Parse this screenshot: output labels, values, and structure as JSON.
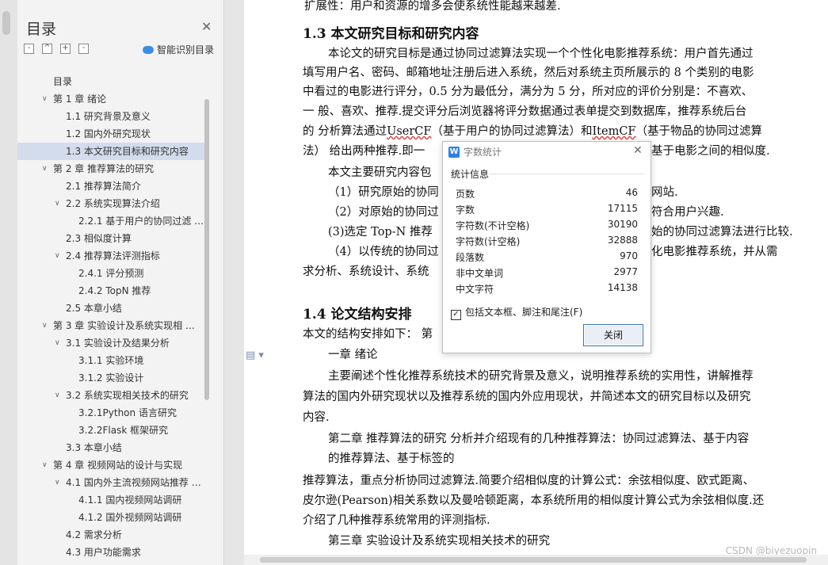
{
  "toc": {
    "title": "目录",
    "smart_label": "智能识别目录",
    "toolbar": [
      "-",
      "^",
      "+",
      "-"
    ],
    "items": [
      {
        "label": "目录",
        "level": 0,
        "chev": ""
      },
      {
        "label": "第 1 章 绪论",
        "level": 0,
        "chev": "v"
      },
      {
        "label": "1.1 研究背景及意义",
        "level": 1,
        "chev": ""
      },
      {
        "label": "1.2 国内外研究现状",
        "level": 1,
        "chev": ""
      },
      {
        "label": "1.3 本文研究目标和研究内容",
        "level": 1,
        "chev": "",
        "selected": true
      },
      {
        "label": "第 2 章 推荐算法的研究",
        "level": 0,
        "chev": "v"
      },
      {
        "label": "2.1 推荐算法简介",
        "level": 1,
        "chev": ""
      },
      {
        "label": "2.2 系统实现算法介绍",
        "level": 1,
        "chev": "v"
      },
      {
        "label": "2.2.1 基于用户的协同过滤 …",
        "level": 2,
        "chev": ""
      },
      {
        "label": "2.3 相似度计算",
        "level": 1,
        "chev": ""
      },
      {
        "label": "2.4 推荐算法评测指标",
        "level": 1,
        "chev": "v"
      },
      {
        "label": "2.4.1 评分预测",
        "level": 2,
        "chev": ""
      },
      {
        "label": "2.4.2 TopN 推荐",
        "level": 2,
        "chev": ""
      },
      {
        "label": "2.5 本章小结",
        "level": 1,
        "chev": ""
      },
      {
        "label": "第 3 章 实验设计及系统实现相 …",
        "level": 0,
        "chev": "v"
      },
      {
        "label": "3.1 实验设计及结果分析",
        "level": 1,
        "chev": "v"
      },
      {
        "label": "3.1.1 实验环境",
        "level": 2,
        "chev": ""
      },
      {
        "label": "3.1.2 实验设计",
        "level": 2,
        "chev": ""
      },
      {
        "label": "3.2 系统实现相关技术的研究",
        "level": 1,
        "chev": "v"
      },
      {
        "label": "3.2.1Python 语言研究",
        "level": 2,
        "chev": ""
      },
      {
        "label": "3.2.2Flask 框架研究",
        "level": 2,
        "chev": ""
      },
      {
        "label": "3.3 本章小结",
        "level": 1,
        "chev": ""
      },
      {
        "label": "第 4 章 视频网站的设计与实现",
        "level": 0,
        "chev": "v"
      },
      {
        "label": "4.1 国内外主流视频网站推荐 …",
        "level": 1,
        "chev": "v"
      },
      {
        "label": "4.1.1 国内视频网站调研",
        "level": 2,
        "chev": ""
      },
      {
        "label": "4.1.2 国外视频网站调研",
        "level": 2,
        "chev": ""
      },
      {
        "label": "4.2 需求分析",
        "level": 1,
        "chev": ""
      },
      {
        "label": "4.3 用户功能需求",
        "level": 1,
        "chev": ""
      }
    ]
  },
  "doc": {
    "lines": [
      "扩展性：用户和资源的增多会使系统性能越来越差.",
      "1.3  本文研究目标和研究内容",
      "本论文的研究目标是通过协同过滤算法实现一个个性化电影推荐系统：用户首先通过",
      "填写用户名、密码、邮箱地址注册后进入系统，然后对系统主页所展示的 8 个类别的电影",
      "中看过的电影进行评分，0.5 分为最低分，满分为 5 分，所对应的评价分别是：不喜欢、",
      "一  般、喜欢、推荐.提交评分后浏览器将评分数据通过表单提交到数据库，推荐系统后台",
      "的  分析算法通过",
      "UserCF",
      "（基于用户的协同过滤算法）和",
      "ItemCF",
      "（基于物品的协同过滤算",
      "法）  给出两种推荐.即一",
      "基于电影之间的相似度.",
      "本文主要研究内容包",
      "（1）研究原始的协同",
      "网站.",
      "（2）对原始的协同过",
      "符合用户兴趣.",
      "(3)选定 Top-N 推荐",
      "始的协同过滤算法进行比较.",
      "（4）以传统的协同过",
      "化电影推荐系统，并从需",
      "求分析、系统设计、系统",
      "1.4 论文结构安排",
      "本文的结构安排如下：  第",
      "一章  绪论",
      "主要阐述个性化推荐系统技术的研究背景及意义，说明推荐系统的实用性，讲解推荐",
      "算法的国内外研究现状以及推荐系统的国内外应用现状，并简述本文的研究目标以及研究",
      "内容.",
      "第二章  推荐算法的研究  分析并介绍现有的几种推荐算法：协同过滤算法、基于内容",
      "的推荐算法、基于标签的",
      "推荐算法，重点分析协同过滤算法.简要介绍相似度的计算公式：余弦相似度、欧式距离、",
      "皮尔逊(Pearson)相关系数以及曼哈顿距离，本系统所用的相似度计算公式为余弦相似度.还",
      "介绍了几种推荐系统常用的评测指标.",
      "第三章  实验设计及系统实现相关技术的研究"
    ],
    "watermark": "CSDN @biyezuopin"
  },
  "dialog": {
    "icon_letter": "W",
    "title": "字数统计",
    "section": "统计信息",
    "stats": [
      {
        "label": "页数",
        "value": "46"
      },
      {
        "label": "字数",
        "value": "17115"
      },
      {
        "label": "字符数(不计空格)",
        "value": "30190"
      },
      {
        "label": "字符数(计空格)",
        "value": "32888"
      },
      {
        "label": "段落数",
        "value": "970"
      },
      {
        "label": "非中文单词",
        "value": "2977"
      },
      {
        "label": "中文字符",
        "value": "14138"
      }
    ],
    "checkbox_label": "包括文本框、脚注和尾注(F)",
    "checkbox_mark": "✓",
    "close_button": "关闭"
  }
}
